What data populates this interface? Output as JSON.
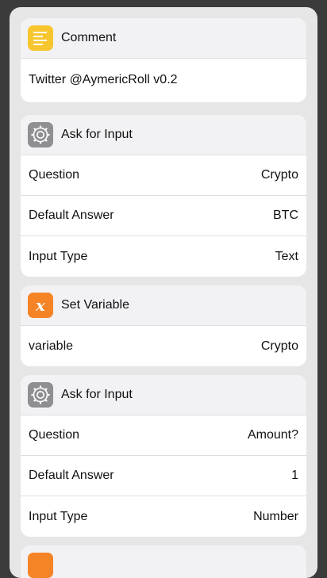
{
  "cards": [
    {
      "title": "Comment",
      "icon": "comment-lines-icon",
      "body": "Twitter @AymericRoll v0.2"
    },
    {
      "title": "Ask for Input",
      "icon": "gear-icon",
      "rows": [
        {
          "label": "Question",
          "value": "Crypto"
        },
        {
          "label": "Default Answer",
          "value": "BTC"
        },
        {
          "label": "Input Type",
          "value": "Text"
        }
      ]
    },
    {
      "title": "Set Variable",
      "icon": "variable-x-icon",
      "glyph": "x",
      "rows": [
        {
          "label": "variable",
          "value": "Crypto"
        }
      ]
    },
    {
      "title": "Ask for Input",
      "icon": "gear-icon",
      "rows": [
        {
          "label": "Question",
          "value": "Amount?"
        },
        {
          "label": "Default Answer",
          "value": "1"
        },
        {
          "label": "Input Type",
          "value": "Number"
        }
      ]
    },
    {
      "icon": "variable-x-icon"
    }
  ],
  "colors": {
    "comment_icon": "#f7c62f",
    "settings_icon": "#8e8e93",
    "variable_icon": "#f58426"
  }
}
